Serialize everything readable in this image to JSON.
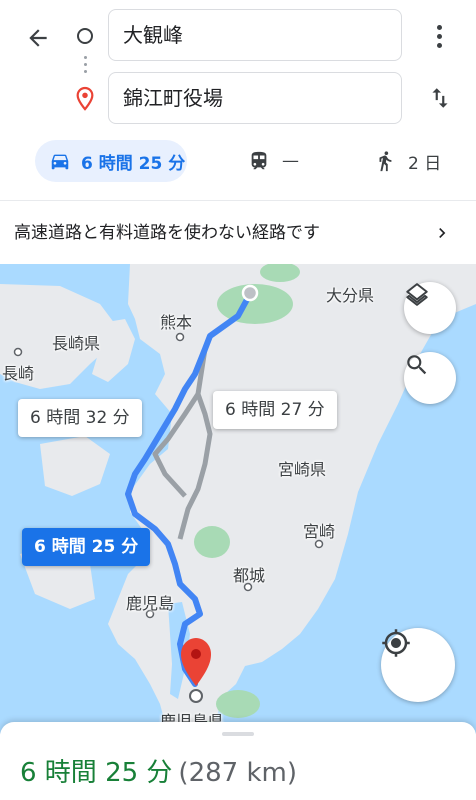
{
  "search": {
    "origin": "大観峰",
    "destination": "錦江町役場"
  },
  "modes": {
    "car_time": "6 時間 25 分",
    "transit_time": "—",
    "walk_time": "2 日"
  },
  "notice": {
    "text": "高速道路と有料道路を使わない経路です"
  },
  "map": {
    "labels": {
      "oita": "大分県",
      "kumamoto": "熊本",
      "nagasaki_pref": "長崎県",
      "nagasaki": "長崎",
      "miyazaki_pref": "宮崎県",
      "miyazaki": "宮崎",
      "miyakonojo": "都城",
      "kagoshima": "鹿児島",
      "kagoshima_pref": "鹿児島県"
    },
    "routes": {
      "alt1": "6 時間 32 分",
      "alt2": "6 時間 27 分",
      "main": "6 時間 25 分"
    },
    "colors": {
      "water": "#aadaff",
      "land": "#e8eaed",
      "park": "#a8dab5",
      "route_main": "#4285f4",
      "route_alt": "#9aa0a6",
      "destination_pin": "#ea4335"
    }
  },
  "summary": {
    "duration": "6 時間 25 分",
    "distance": "(287 km)"
  }
}
